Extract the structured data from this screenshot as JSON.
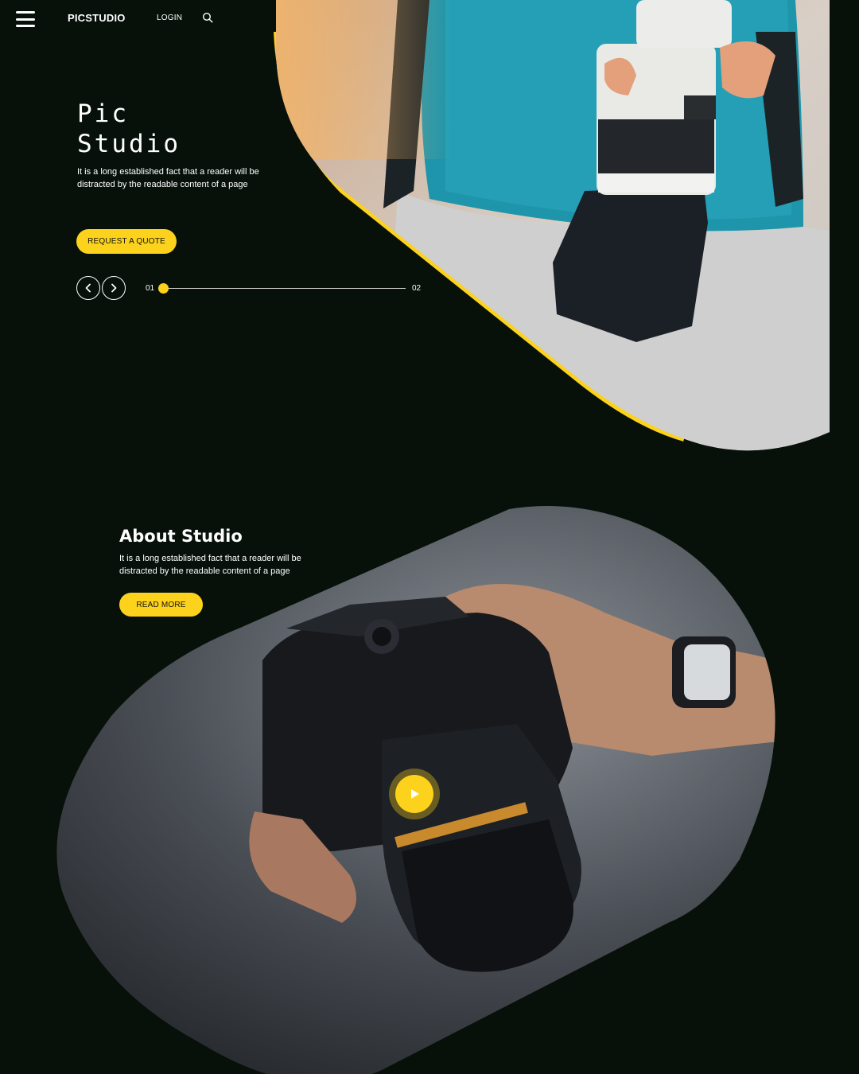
{
  "nav": {
    "brand": "PICSTUDIO",
    "login": "LOGIN",
    "menu_icon": "hamburger-menu-icon",
    "search_icon": "search-icon"
  },
  "hero": {
    "title_line1": "Pic",
    "title_line2": "Studio",
    "description": "It is a long established fact that a reader will be distracted by the readable content of a page",
    "cta_label": "REQUEST A QUOTE",
    "slider": {
      "current_label": "01",
      "total_label": "02",
      "progress": 0
    },
    "prev_icon": "chevron-left-icon",
    "next_icon": "chevron-right-icon"
  },
  "about": {
    "title": "About Studio",
    "description": "It is a long established fact that a reader will be distracted by the readable content of a page",
    "cta_label": "READ MORE",
    "play_icon": "play-icon"
  },
  "colors": {
    "background": "#07110a",
    "accent": "#fcd21c",
    "text": "#ffffff"
  }
}
